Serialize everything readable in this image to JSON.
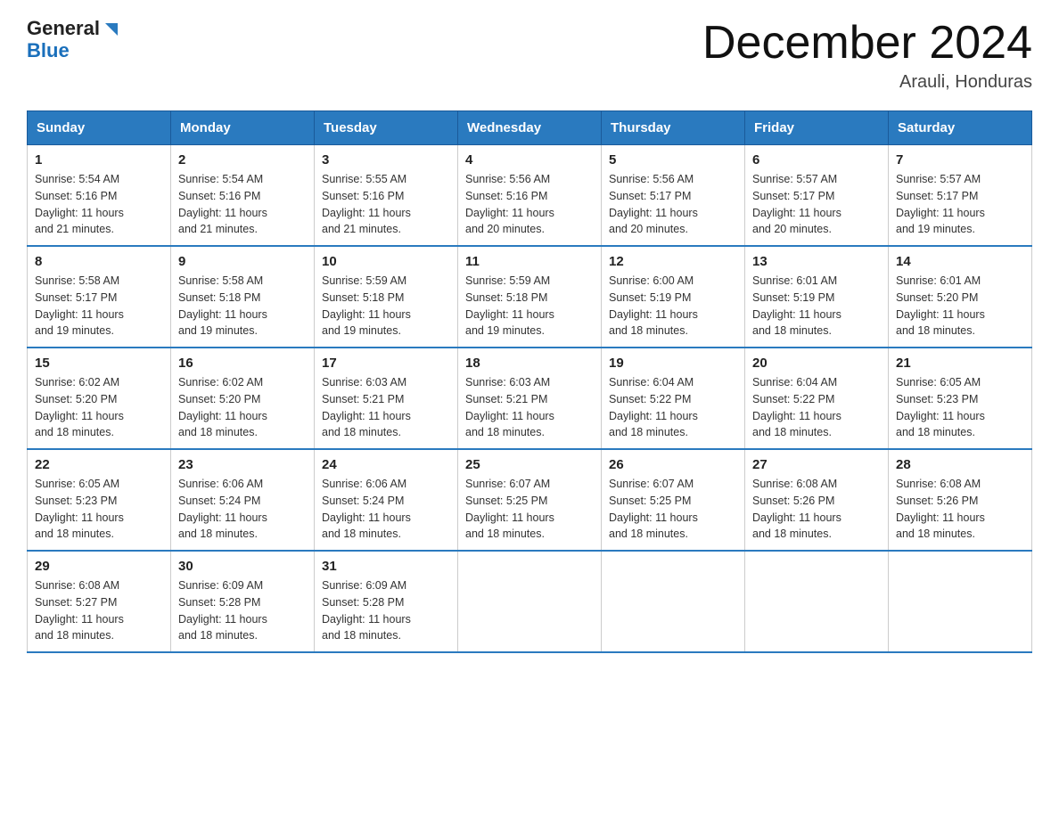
{
  "logo": {
    "general": "General",
    "blue": "Blue"
  },
  "title": "December 2024",
  "location": "Arauli, Honduras",
  "days_of_week": [
    "Sunday",
    "Monday",
    "Tuesday",
    "Wednesday",
    "Thursday",
    "Friday",
    "Saturday"
  ],
  "weeks": [
    [
      {
        "day": "1",
        "sunrise": "5:54 AM",
        "sunset": "5:16 PM",
        "daylight": "11 hours and 21 minutes."
      },
      {
        "day": "2",
        "sunrise": "5:54 AM",
        "sunset": "5:16 PM",
        "daylight": "11 hours and 21 minutes."
      },
      {
        "day": "3",
        "sunrise": "5:55 AM",
        "sunset": "5:16 PM",
        "daylight": "11 hours and 21 minutes."
      },
      {
        "day": "4",
        "sunrise": "5:56 AM",
        "sunset": "5:16 PM",
        "daylight": "11 hours and 20 minutes."
      },
      {
        "day": "5",
        "sunrise": "5:56 AM",
        "sunset": "5:17 PM",
        "daylight": "11 hours and 20 minutes."
      },
      {
        "day": "6",
        "sunrise": "5:57 AM",
        "sunset": "5:17 PM",
        "daylight": "11 hours and 20 minutes."
      },
      {
        "day": "7",
        "sunrise": "5:57 AM",
        "sunset": "5:17 PM",
        "daylight": "11 hours and 19 minutes."
      }
    ],
    [
      {
        "day": "8",
        "sunrise": "5:58 AM",
        "sunset": "5:17 PM",
        "daylight": "11 hours and 19 minutes."
      },
      {
        "day": "9",
        "sunrise": "5:58 AM",
        "sunset": "5:18 PM",
        "daylight": "11 hours and 19 minutes."
      },
      {
        "day": "10",
        "sunrise": "5:59 AM",
        "sunset": "5:18 PM",
        "daylight": "11 hours and 19 minutes."
      },
      {
        "day": "11",
        "sunrise": "5:59 AM",
        "sunset": "5:18 PM",
        "daylight": "11 hours and 19 minutes."
      },
      {
        "day": "12",
        "sunrise": "6:00 AM",
        "sunset": "5:19 PM",
        "daylight": "11 hours and 18 minutes."
      },
      {
        "day": "13",
        "sunrise": "6:01 AM",
        "sunset": "5:19 PM",
        "daylight": "11 hours and 18 minutes."
      },
      {
        "day": "14",
        "sunrise": "6:01 AM",
        "sunset": "5:20 PM",
        "daylight": "11 hours and 18 minutes."
      }
    ],
    [
      {
        "day": "15",
        "sunrise": "6:02 AM",
        "sunset": "5:20 PM",
        "daylight": "11 hours and 18 minutes."
      },
      {
        "day": "16",
        "sunrise": "6:02 AM",
        "sunset": "5:20 PM",
        "daylight": "11 hours and 18 minutes."
      },
      {
        "day": "17",
        "sunrise": "6:03 AM",
        "sunset": "5:21 PM",
        "daylight": "11 hours and 18 minutes."
      },
      {
        "day": "18",
        "sunrise": "6:03 AM",
        "sunset": "5:21 PM",
        "daylight": "11 hours and 18 minutes."
      },
      {
        "day": "19",
        "sunrise": "6:04 AM",
        "sunset": "5:22 PM",
        "daylight": "11 hours and 18 minutes."
      },
      {
        "day": "20",
        "sunrise": "6:04 AM",
        "sunset": "5:22 PM",
        "daylight": "11 hours and 18 minutes."
      },
      {
        "day": "21",
        "sunrise": "6:05 AM",
        "sunset": "5:23 PM",
        "daylight": "11 hours and 18 minutes."
      }
    ],
    [
      {
        "day": "22",
        "sunrise": "6:05 AM",
        "sunset": "5:23 PM",
        "daylight": "11 hours and 18 minutes."
      },
      {
        "day": "23",
        "sunrise": "6:06 AM",
        "sunset": "5:24 PM",
        "daylight": "11 hours and 18 minutes."
      },
      {
        "day": "24",
        "sunrise": "6:06 AM",
        "sunset": "5:24 PM",
        "daylight": "11 hours and 18 minutes."
      },
      {
        "day": "25",
        "sunrise": "6:07 AM",
        "sunset": "5:25 PM",
        "daylight": "11 hours and 18 minutes."
      },
      {
        "day": "26",
        "sunrise": "6:07 AM",
        "sunset": "5:25 PM",
        "daylight": "11 hours and 18 minutes."
      },
      {
        "day": "27",
        "sunrise": "6:08 AM",
        "sunset": "5:26 PM",
        "daylight": "11 hours and 18 minutes."
      },
      {
        "day": "28",
        "sunrise": "6:08 AM",
        "sunset": "5:26 PM",
        "daylight": "11 hours and 18 minutes."
      }
    ],
    [
      {
        "day": "29",
        "sunrise": "6:08 AM",
        "sunset": "5:27 PM",
        "daylight": "11 hours and 18 minutes."
      },
      {
        "day": "30",
        "sunrise": "6:09 AM",
        "sunset": "5:28 PM",
        "daylight": "11 hours and 18 minutes."
      },
      {
        "day": "31",
        "sunrise": "6:09 AM",
        "sunset": "5:28 PM",
        "daylight": "11 hours and 18 minutes."
      },
      null,
      null,
      null,
      null
    ]
  ]
}
